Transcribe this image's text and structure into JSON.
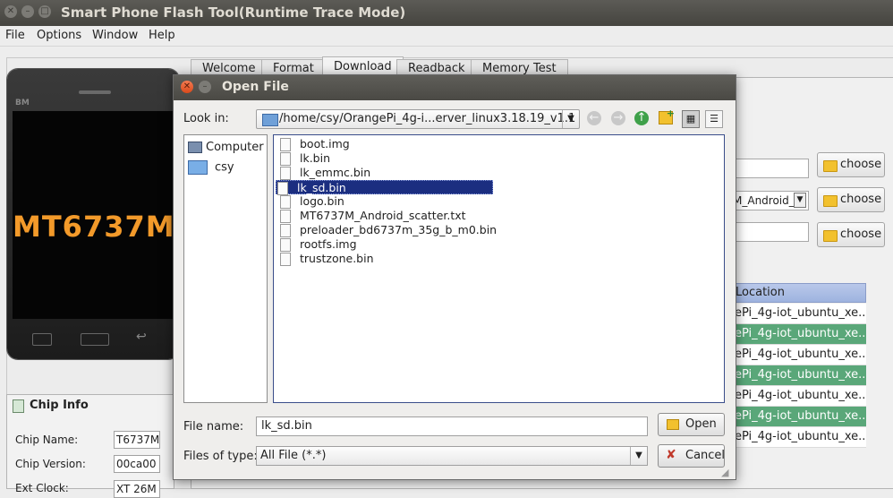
{
  "app": {
    "title": "Smart Phone Flash Tool(Runtime Trace Mode)",
    "menu": [
      "File",
      "Options",
      "Window",
      "Help"
    ],
    "tabs": [
      "Welcome",
      "Format",
      "Download",
      "Readback",
      "Memory Test"
    ],
    "active_tab": "Download",
    "phone": {
      "brand": "BM",
      "model": "MT6737M"
    },
    "choose_label": "choose",
    "scatter_combo_partial": "M_Android_",
    "table": {
      "header": "Location",
      "rows": [
        "ePi_4g-iot_ubuntu_xe...",
        "ePi_4g-iot_ubuntu_xe...",
        "ePi_4g-iot_ubuntu_xe...",
        "ePi_4g-iot_ubuntu_xe...",
        "ePi_4g-iot_ubuntu_xe...",
        "ePi_4g-iot_ubuntu_xe...",
        "ePi_4g-iot_ubuntu_xe..."
      ]
    },
    "chip_info": {
      "title": "Chip Info",
      "name_label": "Chip Name:",
      "name_value": "T6737M",
      "version_label": "Chip Version:",
      "version_value": "00ca00",
      "ext_label": "Ext Clock:",
      "ext_value": "XT 26M"
    }
  },
  "dialog": {
    "title": "Open File",
    "look_in_label": "Look in:",
    "look_in_path": "/home/csy/OrangePi_4g-i...erver_linux3.18.19_v1.1",
    "sidebar": [
      "Computer",
      "csy"
    ],
    "files": [
      "boot.img",
      "lk.bin",
      "lk_emmc.bin",
      "lk_sd.bin",
      "logo.bin",
      "MT6737M_Android_scatter.txt",
      "preloader_bd6737m_35g_b_m0.bin",
      "rootfs.img",
      "trustzone.bin"
    ],
    "selected_file": "lk_sd.bin",
    "file_name_label": "File name:",
    "file_name_value": "lk_sd.bin",
    "files_of_type_label": "Files of type:",
    "files_of_type_value": "All File (*.*)",
    "open_label": "Open",
    "cancel_label": "Cancel"
  }
}
